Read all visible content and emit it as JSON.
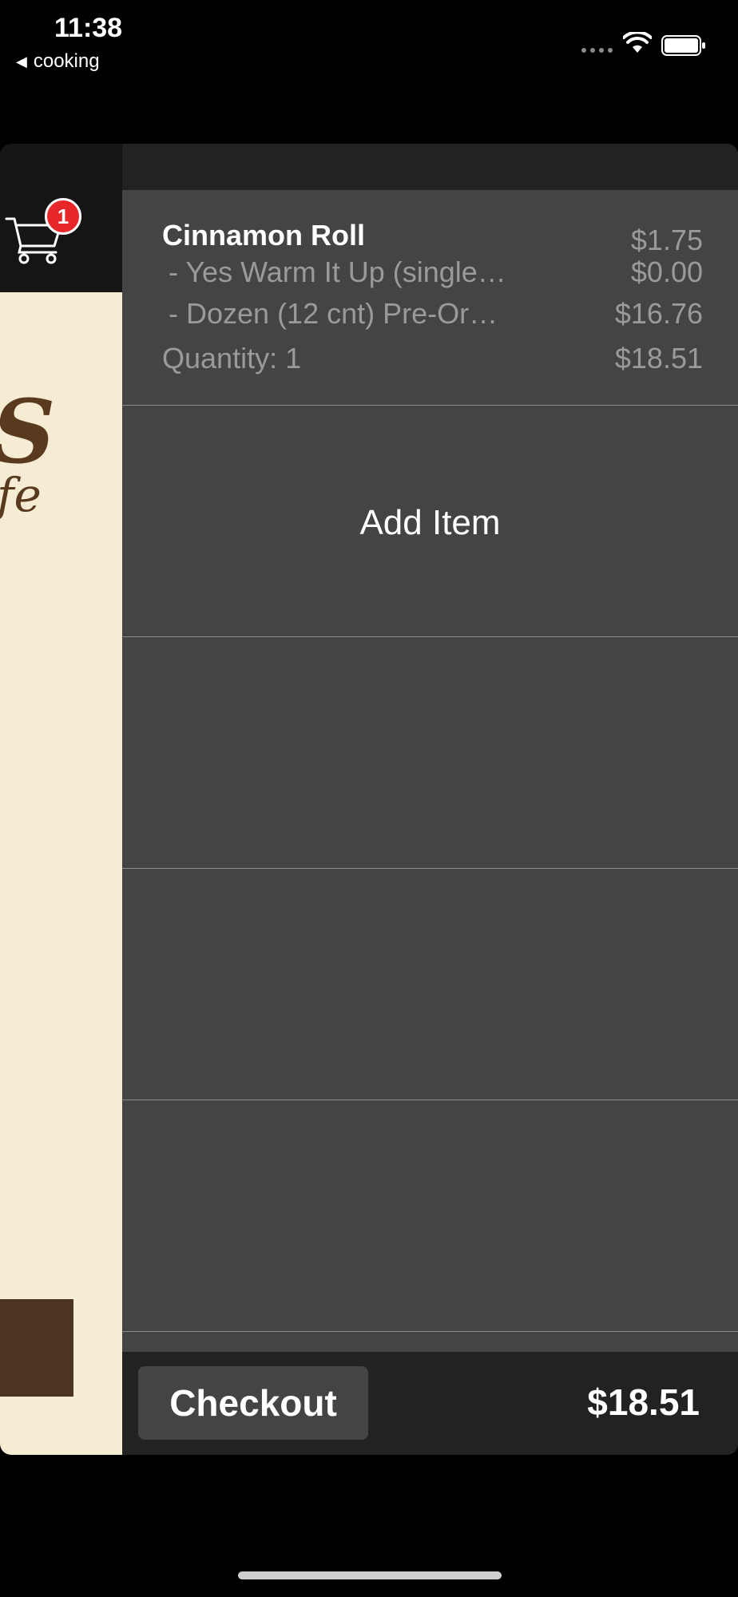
{
  "status_bar": {
    "time": "11:38",
    "back_label": "cooking"
  },
  "cart_button": {
    "icon": "cart-icon",
    "badge_count": "1",
    "badge_color": "#e7262a"
  },
  "left_pane": {
    "logo_text_top": "S",
    "logo_text_bottom": "fe",
    "background": "#f5ecd3",
    "block_color": "#4b3520"
  },
  "cart": {
    "items": [
      {
        "name": "Cinnamon Roll",
        "price": "$1.75",
        "modifiers": [
          {
            "name": "- Yes Warm It Up (single…",
            "price": "$0.00"
          },
          {
            "name": "- Dozen (12 cnt) Pre-Or…",
            "price": "$16.76"
          }
        ],
        "quantity_label": "Quantity: 1",
        "total": "$18.51"
      }
    ],
    "add_item_label": "Add Item"
  },
  "footer": {
    "checkout_label": "Checkout",
    "total": "$18.51"
  },
  "colors": {
    "panel_bg": "#444444",
    "header_bg": "#222222",
    "muted_text": "#9a9a9a"
  }
}
